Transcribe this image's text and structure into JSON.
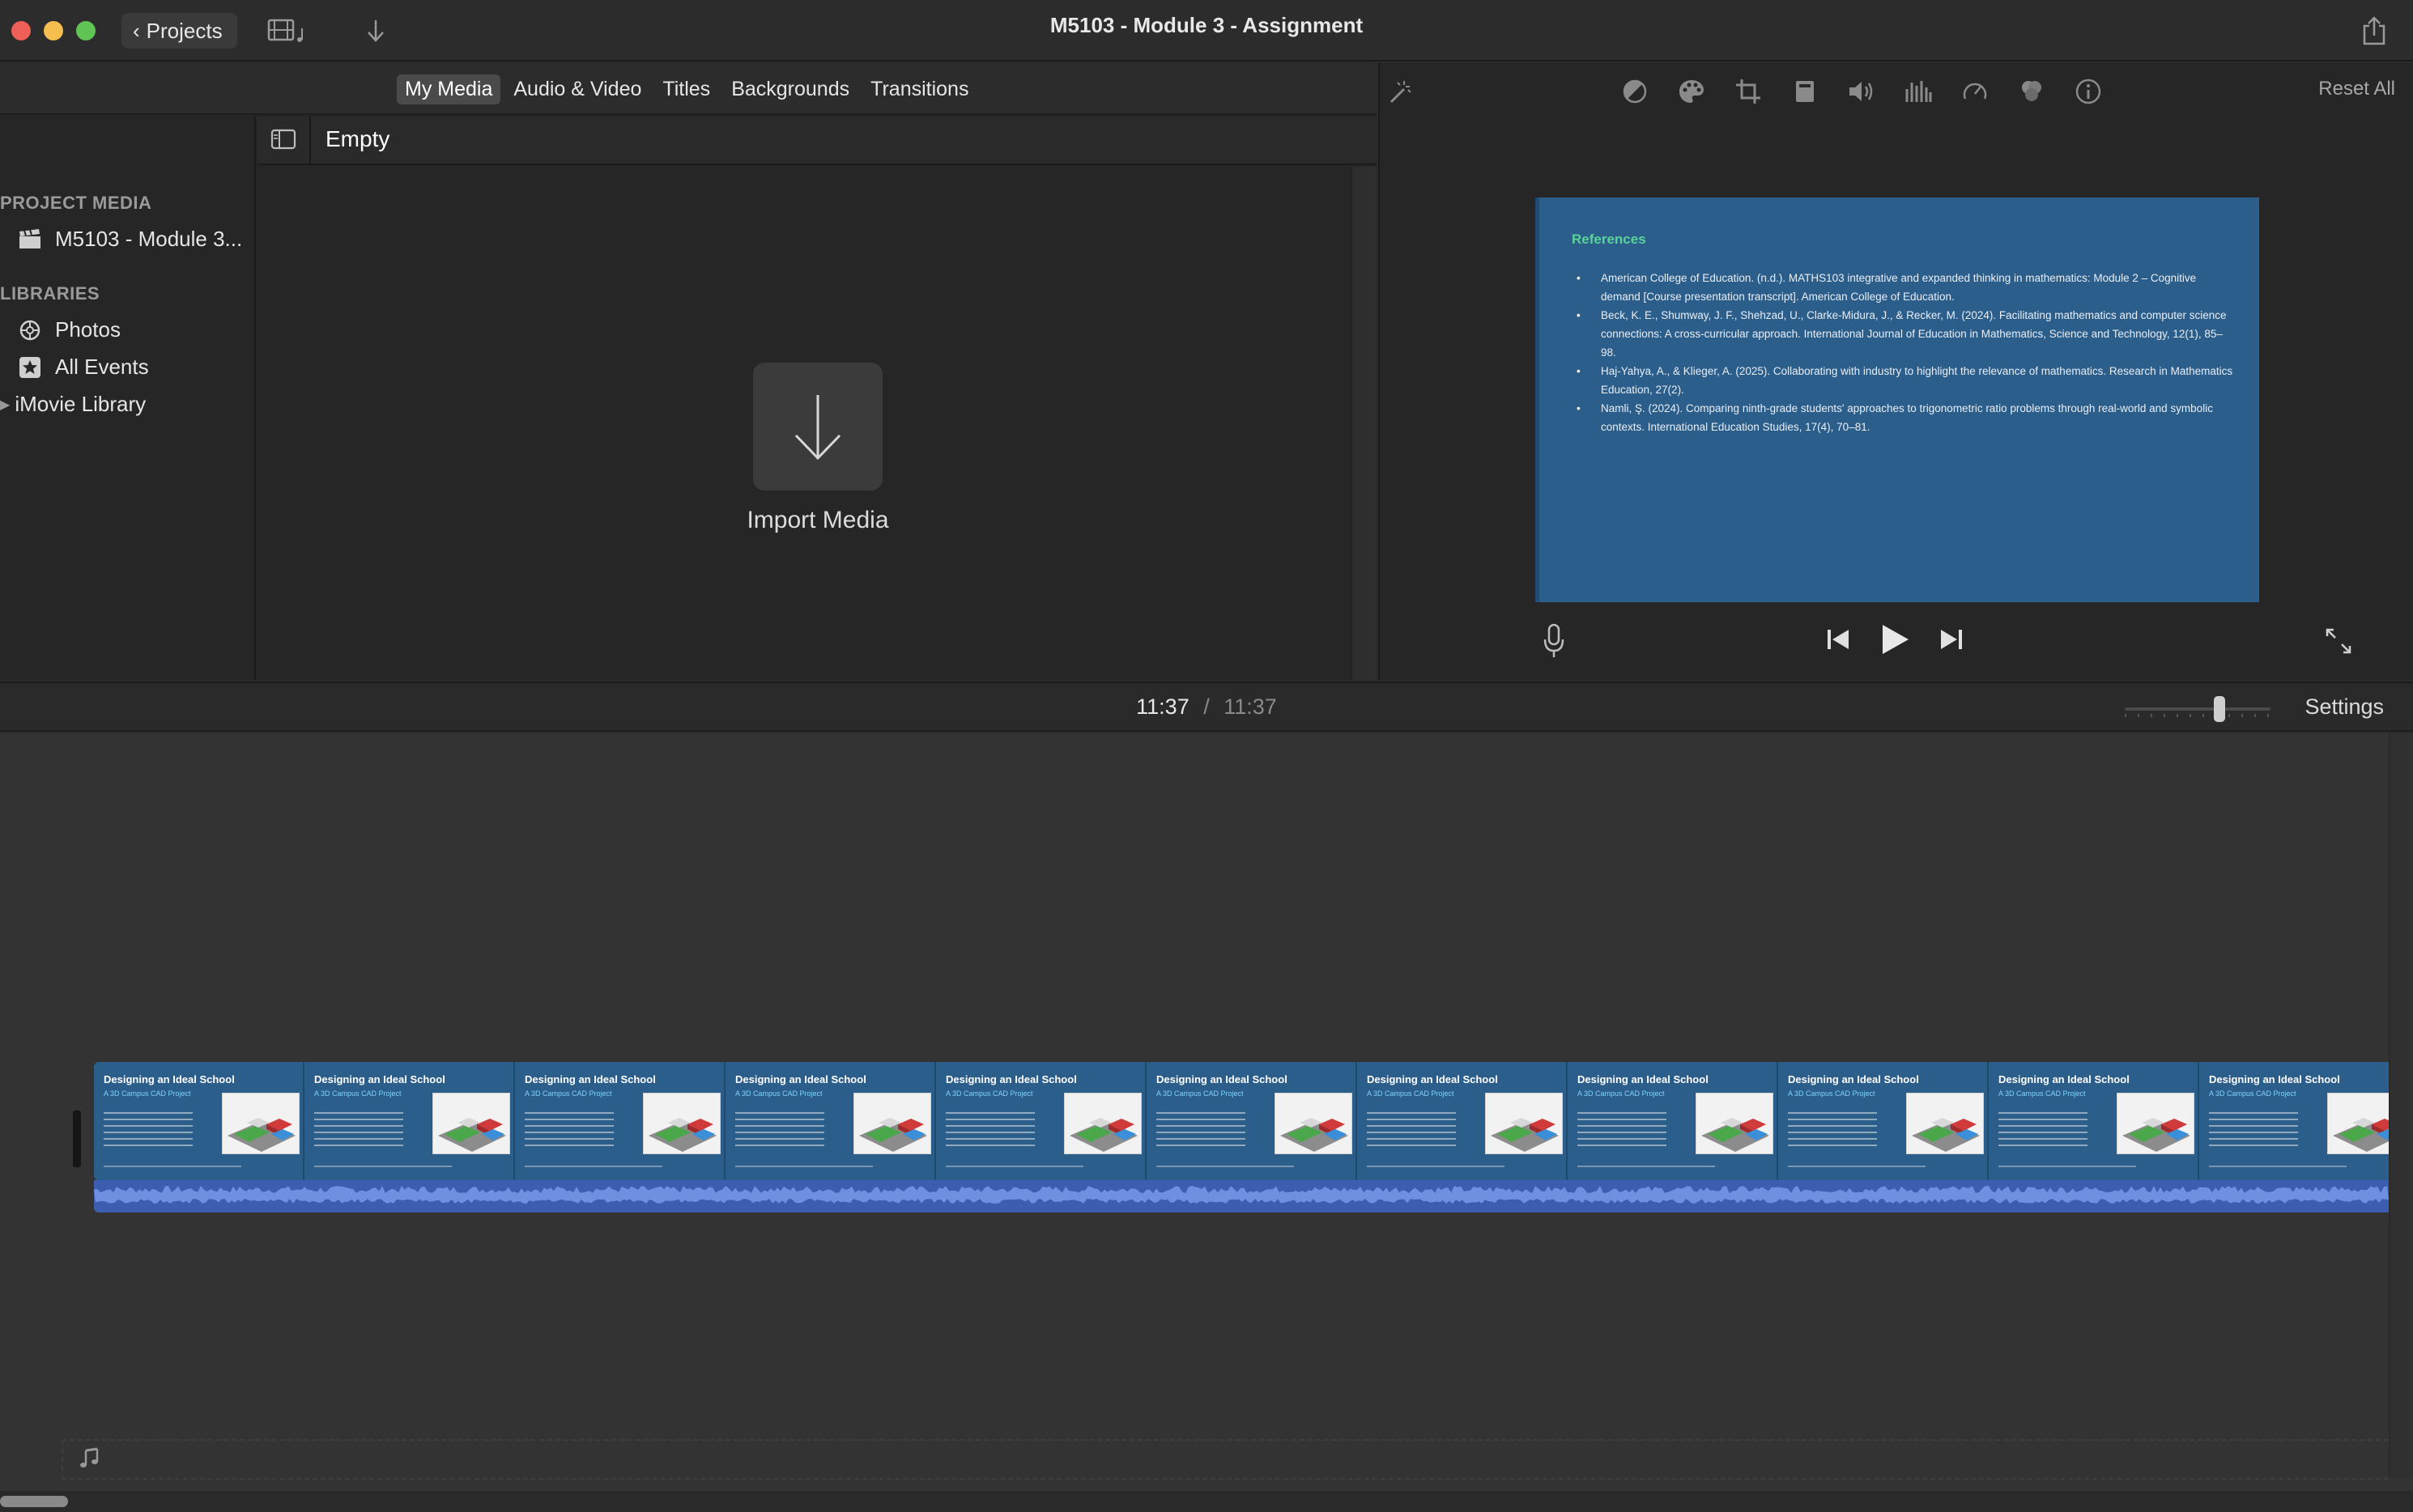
{
  "window": {
    "title": "M5103 - Module 3 - Assignment",
    "projects_label": "Projects"
  },
  "browser": {
    "tabs": [
      {
        "label": "My Media",
        "active": true
      },
      {
        "label": "Audio & Video",
        "active": false
      },
      {
        "label": "Titles",
        "active": false
      },
      {
        "label": "Backgrounds",
        "active": false
      },
      {
        "label": "Transitions",
        "active": false
      }
    ],
    "sidebar": {
      "project_media_header": "PROJECT MEDIA",
      "project_item": "M5103 - Module 3...",
      "libraries_header": "LIBRARIES",
      "photos": "Photos",
      "all_events": "All Events",
      "imovie_library": "iMovie Library"
    },
    "media": {
      "filter_label": "Empty",
      "import_label": "Import Media"
    }
  },
  "viewer": {
    "reset_all": "Reset All",
    "slide": {
      "title": "References",
      "references": [
        "American College of Education. (n.d.). MATHS103 integrative and expanded thinking in mathematics: Module 2 – Cognitive demand [Course presentation transcript]. American College of Education.",
        "Beck, K. E., Shumway, J. F., Shehzad, U., Clarke-Midura, J., & Recker, M. (2024). Facilitating mathematics and computer science connections: A cross-curricular approach. International Journal of Education in Mathematics, Science and Technology, 12(1), 85–98.",
        "Haj-Yahya, A., & Klieger, A. (2025). Collaborating with industry to highlight the relevance of mathematics. Research in Mathematics Education, 27(2).",
        "Namli, Ş. (2024). Comparing ninth-grade students' approaches to trigonometric ratio problems through real-world and symbolic contexts. International Education Studies, 17(4), 70–81."
      ]
    }
  },
  "timeline": {
    "current_time": "11:37",
    "separator": "/",
    "total_time": "11:37",
    "settings_label": "Settings",
    "clip": {
      "thumbnail_title": "Designing an Ideal School",
      "thumbnail_subtitle": "A 3D Campus CAD Project",
      "thumbnail_count": 11,
      "colors": {
        "video": "#2c5e8c",
        "audio": "#3d5eb0"
      }
    }
  },
  "colors": {
    "window_bg": "#262626",
    "timeline_bg": "#333333",
    "accent_green": "#5ad39a"
  }
}
